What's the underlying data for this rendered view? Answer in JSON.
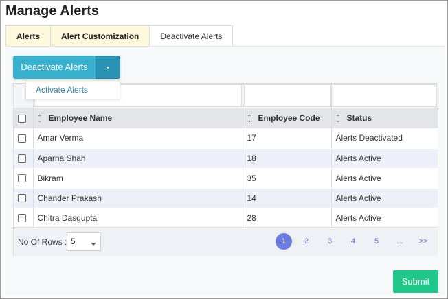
{
  "page": {
    "title": "Manage Alerts"
  },
  "tabs": [
    {
      "label": "Alerts"
    },
    {
      "label": "Alert Customization"
    },
    {
      "label": "Deactivate Alerts"
    }
  ],
  "action": {
    "main_label": "Deactivate Alerts",
    "menu_item": "Activate Alerts"
  },
  "table": {
    "columns": [
      "Employee Name",
      "Employee Code",
      "Status"
    ],
    "rows": [
      {
        "name": "Amar Verma",
        "code": "17",
        "status": "Alerts Deactivated"
      },
      {
        "name": "Aparna Shah",
        "code": "18",
        "status": "Alerts Active"
      },
      {
        "name": "Bikram",
        "code": "35",
        "status": "Alerts Active"
      },
      {
        "name": "Chander Prakash",
        "code": "14",
        "status": "Alerts Active"
      },
      {
        "name": "Chitra Dasgupta",
        "code": "28",
        "status": "Alerts Active"
      }
    ]
  },
  "footer": {
    "rows_label": "No Of Rows :",
    "rows_value": "5",
    "pages": [
      "1",
      "2",
      "3",
      "4",
      "5",
      "...",
      ">>"
    ],
    "current_page": "1"
  },
  "submit_label": "Submit",
  "colors": {
    "primary": "#3ab0cf",
    "submit": "#21c68b",
    "pager_active": "#6b7de0",
    "tab_bg": "#fdf7dc"
  }
}
